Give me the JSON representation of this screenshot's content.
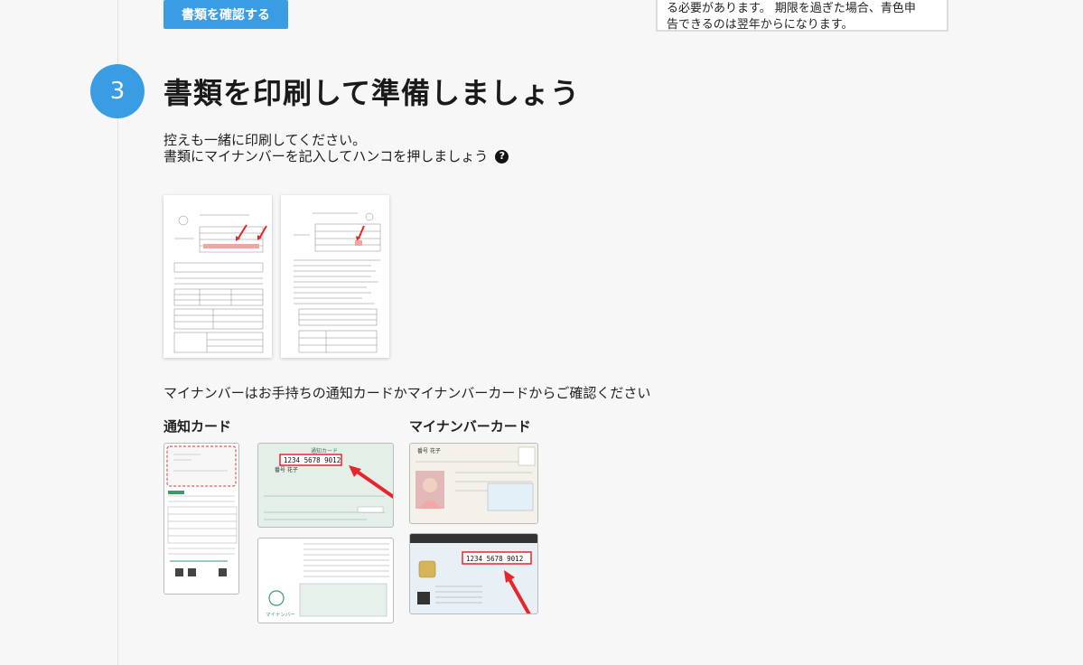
{
  "top": {
    "confirm_button_label": "書類を確認する",
    "note_line1": "る必要があります。 期限を過ぎた場合、青色申",
    "note_line2": "告できるのは翌年からになります。"
  },
  "step": {
    "number": "3",
    "title": "書類を印刷して準備しましょう",
    "desc_line1": "控えも一緒に印刷してください。",
    "desc_line2": "書類にマイナンバーを記入してハンコを押しましょう",
    "help_icon": "question-circle-icon",
    "help_glyph": "?"
  },
  "mynumber": {
    "note": "マイナンバーはお手持ちの通知カードかマイナンバーカードからご確認ください",
    "notice_card_label": "通知カード",
    "mynumber_card_label": "マイナンバーカード"
  },
  "card_texts": {
    "number_sample": "1234 5678 9012",
    "notice_front_header": "通知カード",
    "notice_name": "番号 花子",
    "notice_back_caption": "マイナンバー",
    "card_name": "番号 花子"
  },
  "colors": {
    "accent": "#3a9de3",
    "arrow": "#e8242c"
  }
}
